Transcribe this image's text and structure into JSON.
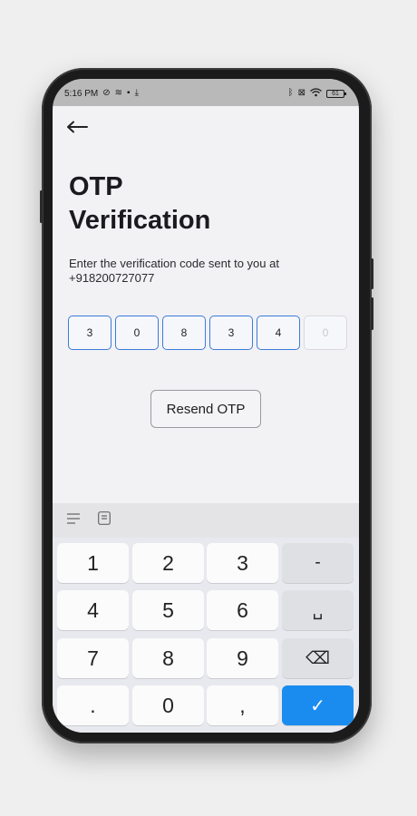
{
  "status_bar": {
    "time": "5:16 PM",
    "left_icons": [
      "do-not-disturb-icon",
      "cast-icon",
      "delete-icon",
      "download-icon"
    ],
    "right_icons": [
      "bluetooth-icon",
      "no-sim-icon",
      "wifi-icon"
    ],
    "battery": "61"
  },
  "header": {
    "title_line1": "OTP",
    "title_line2": "Verification"
  },
  "instruction": {
    "text": "Enter the verification code sent to you at",
    "phone": "+918200727077"
  },
  "otp": {
    "digits": [
      "3",
      "0",
      "8",
      "3",
      "4",
      "0"
    ],
    "filled_count": 5
  },
  "resend_label": "Resend OTP",
  "keyboard": {
    "rows": [
      [
        "1",
        "2",
        "3",
        "-"
      ],
      [
        "4",
        "5",
        "6",
        "␣"
      ],
      [
        "7",
        "8",
        "9",
        "⌫"
      ],
      [
        ".",
        "0",
        ",",
        "✓"
      ]
    ]
  },
  "colors": {
    "accent": "#1a8cf0",
    "otp_border": "#3d7bd9",
    "background": "#f2f2f5"
  }
}
